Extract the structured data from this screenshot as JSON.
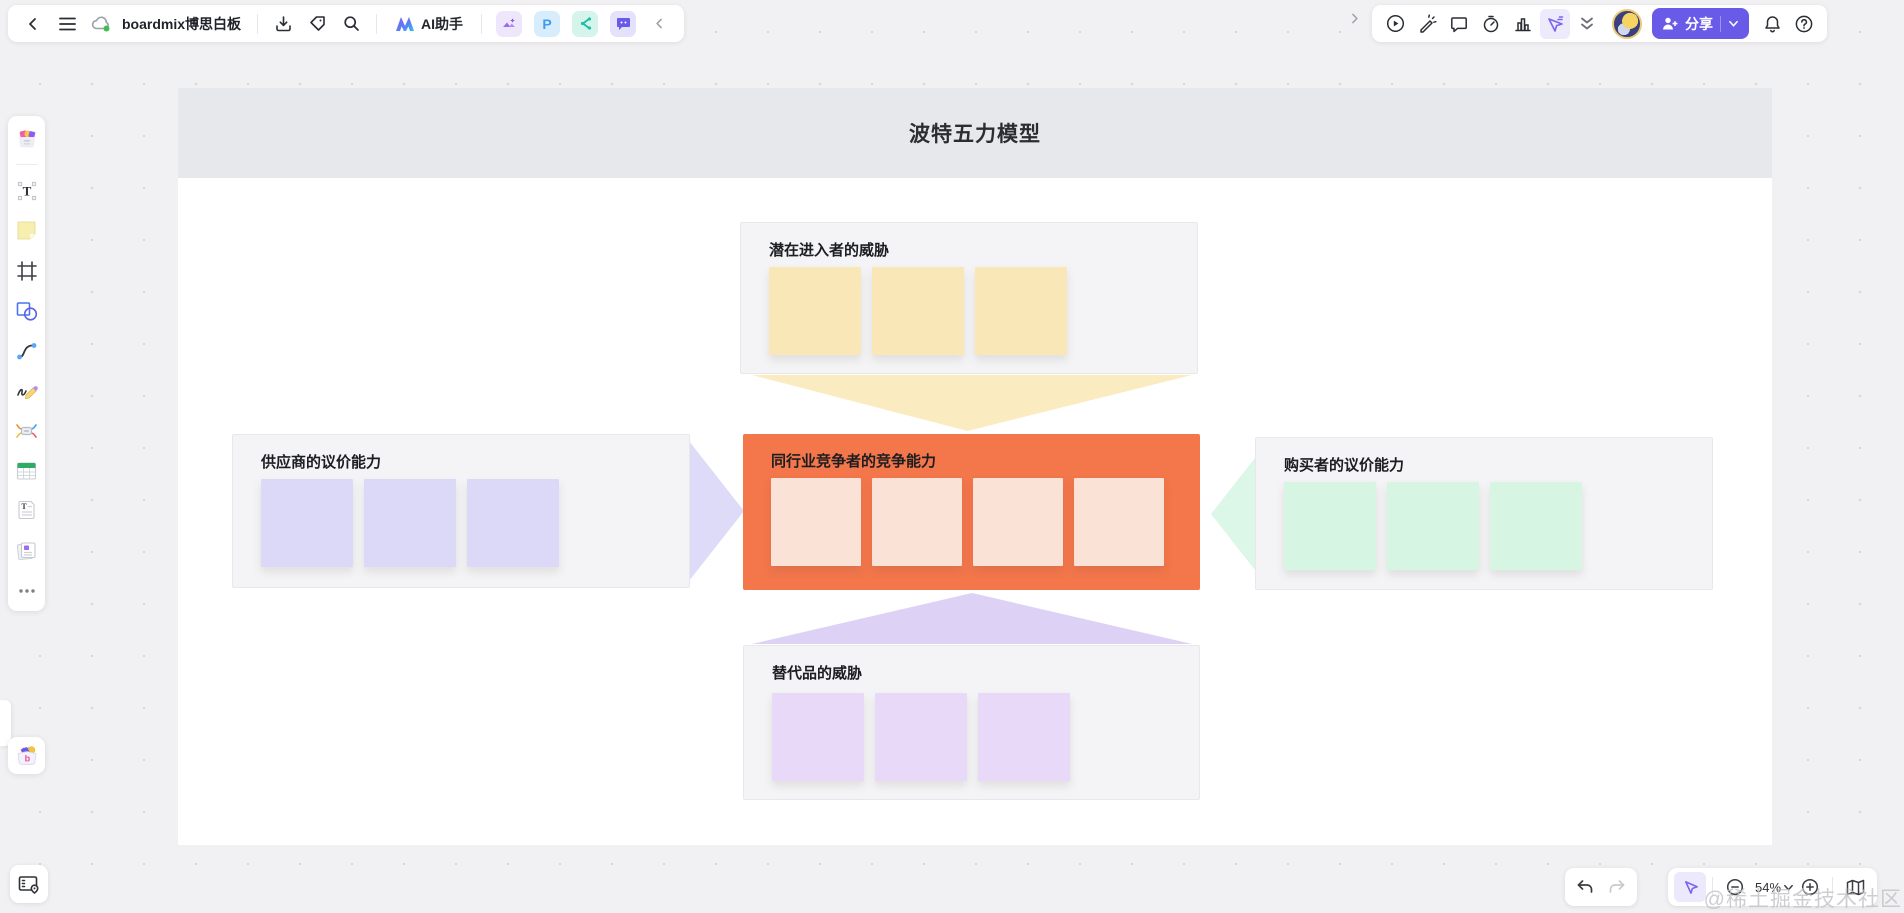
{
  "header": {
    "board_title": "boardmix博思白板",
    "ai_assistant_label": "AI助手",
    "share_button_label": "分享",
    "plugin_p_glyph": "P"
  },
  "diagram": {
    "frame_title": "波特五力模型",
    "forces": [
      {
        "key": "new-entrants",
        "label": "潜在进入者的威胁",
        "box_bg": "#f4f4f6",
        "note_color": "#fae7b8",
        "notes": 3
      },
      {
        "key": "suppliers",
        "label": "供应商的议价能力",
        "box_bg": "#f4f4f6",
        "note_color": "#dbd8f8",
        "notes": 3
      },
      {
        "key": "rivalry",
        "label": "同行业竞争者的竞争能力",
        "box_bg": "#f4764b",
        "note_color": "#fae2d7",
        "notes": 4
      },
      {
        "key": "buyers",
        "label": "购买者的议价能力",
        "box_bg": "#f4f4f6",
        "note_color": "#d6f5e3",
        "notes": 3
      },
      {
        "key": "substitutes",
        "label": "替代品的威胁",
        "box_bg": "#f4f4f6",
        "note_color": "#e9d9f8",
        "notes": 3
      }
    ],
    "arrows": {
      "down_from_entrants": "#fbebc0",
      "right_from_suppliers": "#dedbf9",
      "left_from_buyers": "#dcf6e8",
      "up_from_substitutes": "#ddd1f5"
    },
    "accent_color": "#6a5ae8"
  },
  "footer": {
    "zoom_level": "54%"
  },
  "watermark": "@稀土掘金技术社区"
}
